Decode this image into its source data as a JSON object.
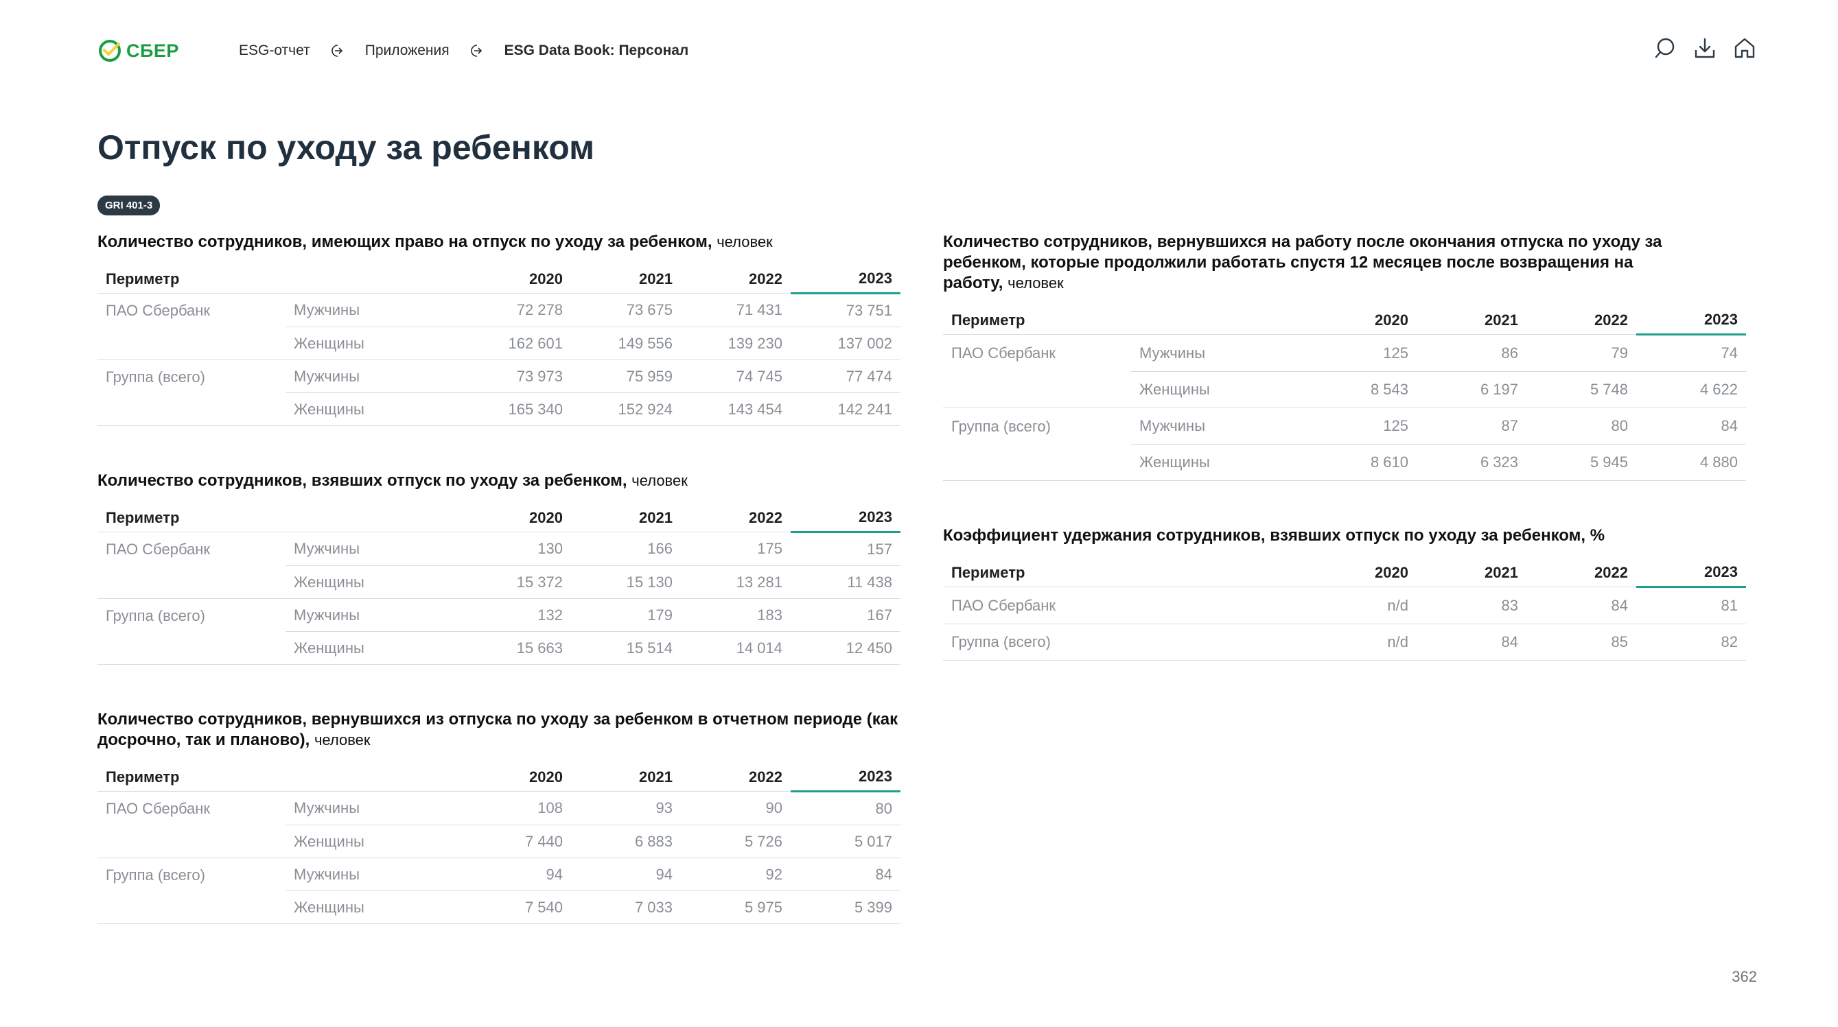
{
  "header": {
    "logo_text": "СБЕР",
    "logo_color": "#1b9e42",
    "breadcrumbs": [
      "ESG-отчет",
      "Приложения",
      "ESG Data Book: Персонал"
    ],
    "icons": [
      "search-icon",
      "download-icon",
      "home-icon"
    ]
  },
  "page": {
    "title": "Отпуск по уходу за ребенком",
    "badge": "GRI 401-3",
    "number": "362",
    "accent_color": "#1d9f8e"
  },
  "tables": {
    "entitled": {
      "title": "Количество сотрудников, имеющих право на отпуск по уходу за ребенком,",
      "unit": "человек",
      "headers": [
        "Периметр",
        "2020",
        "2021",
        "2022",
        "2023"
      ],
      "groups": [
        {
          "entity": "ПАО Сбербанк",
          "rows": [
            {
              "label": "Мужчины",
              "values": [
                "72 278",
                "73 675",
                "71 431",
                "73 751"
              ]
            },
            {
              "label": "Женщины",
              "values": [
                "162 601",
                "149 556",
                "139 230",
                "137 002"
              ]
            }
          ]
        },
        {
          "entity": "Группа (всего)",
          "rows": [
            {
              "label": "Мужчины",
              "values": [
                "73 973",
                "75 959",
                "74 745",
                "77 474"
              ]
            },
            {
              "label": "Женщины",
              "values": [
                "165 340",
                "152 924",
                "143 454",
                "142 241"
              ]
            }
          ]
        }
      ]
    },
    "took": {
      "title": "Количество сотрудников, взявших отпуск по уходу за ребенком,",
      "unit": "человек",
      "headers": [
        "Периметр",
        "2020",
        "2021",
        "2022",
        "2023"
      ],
      "groups": [
        {
          "entity": "ПАО Сбербанк",
          "rows": [
            {
              "label": "Мужчины",
              "values": [
                "130",
                "166",
                "175",
                "157"
              ]
            },
            {
              "label": "Женщины",
              "values": [
                "15 372",
                "15 130",
                "13 281",
                "11 438"
              ]
            }
          ]
        },
        {
          "entity": "Группа (всего)",
          "rows": [
            {
              "label": "Мужчины",
              "values": [
                "132",
                "179",
                "183",
                "167"
              ]
            },
            {
              "label": "Женщины",
              "values": [
                "15 663",
                "15 514",
                "14 014",
                "12 450"
              ]
            }
          ]
        }
      ]
    },
    "returned": {
      "title": "Количество сотрудников, вернувшихся из отпуска по уходу за ребенком в отчетном периоде (как досрочно, так и планово),",
      "unit": "человек",
      "headers": [
        "Периметр",
        "2020",
        "2021",
        "2022",
        "2023"
      ],
      "groups": [
        {
          "entity": "ПАО Сбербанк",
          "rows": [
            {
              "label": "Мужчины",
              "values": [
                "108",
                "93",
                "90",
                "80"
              ]
            },
            {
              "label": "Женщины",
              "values": [
                "7 440",
                "6 883",
                "5 726",
                "5 017"
              ]
            }
          ]
        },
        {
          "entity": "Группа (всего)",
          "rows": [
            {
              "label": "Мужчины",
              "values": [
                "94",
                "94",
                "92",
                "84"
              ]
            },
            {
              "label": "Женщины",
              "values": [
                "7 540",
                "7 033",
                "5 975",
                "5 399"
              ]
            }
          ]
        }
      ]
    },
    "stayed": {
      "title": "Количество сотрудников, вернувшихся на работу после окончания отпуска по уходу за ребенком, которые продолжили работать спустя 12 месяцев после возвращения на работу,",
      "unit": "человек",
      "headers": [
        "Периметр",
        "2020",
        "2021",
        "2022",
        "2023"
      ],
      "groups": [
        {
          "entity": "ПАО Сбербанк",
          "rows": [
            {
              "label": "Мужчины",
              "values": [
                "125",
                "86",
                "79",
                "74"
              ]
            },
            {
              "label": "Женщины",
              "values": [
                "8 543",
                "6 197",
                "5 748",
                "4 622"
              ]
            }
          ]
        },
        {
          "entity": "Группа (всего)",
          "rows": [
            {
              "label": "Мужчины",
              "values": [
                "125",
                "87",
                "80",
                "84"
              ]
            },
            {
              "label": "Женщины",
              "values": [
                "8 610",
                "6 323",
                "5 945",
                "4 880"
              ]
            }
          ]
        }
      ]
    },
    "retention": {
      "title": "Коэффициент удержания сотрудников, взявших отпуск по уходу за ребенком, %",
      "headers": [
        "Периметр",
        "2020",
        "2021",
        "2022",
        "2023"
      ],
      "rows": [
        {
          "entity": "ПАО Сбербанк",
          "values": [
            "n/d",
            "83",
            "84",
            "81"
          ]
        },
        {
          "entity": "Группа (всего)",
          "values": [
            "n/d",
            "84",
            "85",
            "82"
          ]
        }
      ]
    }
  }
}
